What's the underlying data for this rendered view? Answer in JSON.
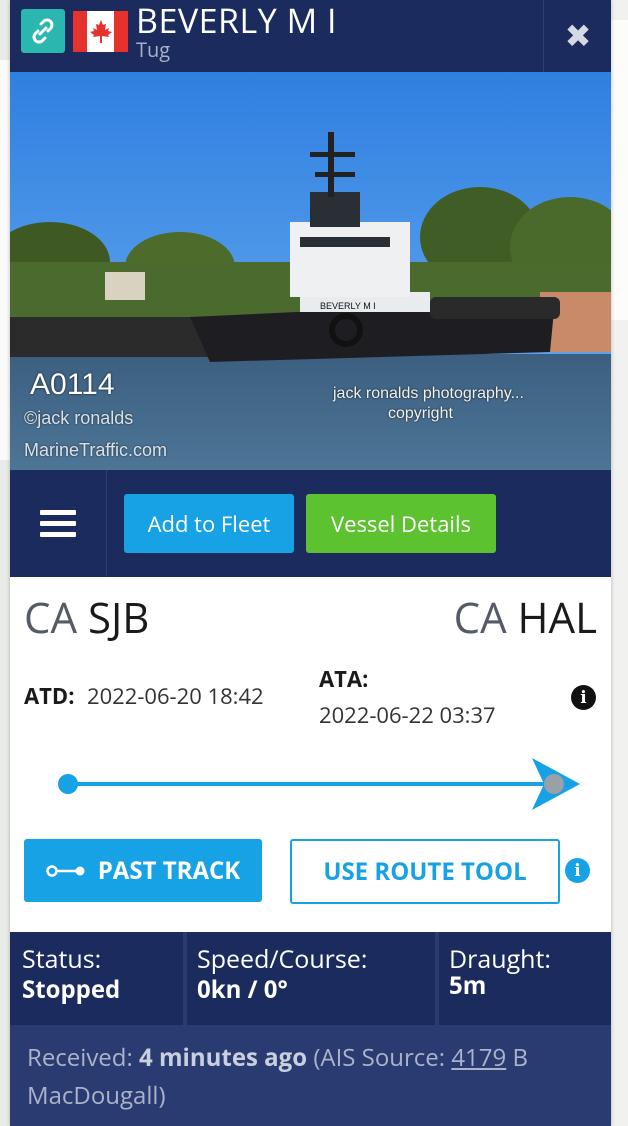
{
  "header": {
    "vessel_name": "BEVERLY M I",
    "vessel_type": "Tug",
    "close_symbol": "✖",
    "flag_country": "Canada"
  },
  "photo": {
    "caption_id": "A0114",
    "caption_credit": "©jack ronalds",
    "caption_site": "MarineTraffic.com",
    "watermark_line1": "jack ronalds photography...",
    "watermark_line2": "copyright",
    "hull_name": "BEVERLY M I"
  },
  "actions": {
    "add_to_fleet": "Add to Fleet",
    "vessel_details": "Vessel Details"
  },
  "voyage": {
    "origin_country": "CA",
    "origin_port": "SJB",
    "destination_country": "CA",
    "destination_port": "HAL",
    "atd_label": "ATD:",
    "atd_value": "2022-06-20 18:42",
    "ata_label": "ATA:",
    "ata_value": "2022-06-22 03:37",
    "progress": 1.0
  },
  "track": {
    "past_track": "PAST TRACK",
    "route_tool": "USE ROUTE TOOL"
  },
  "status": {
    "status_label": "Status:",
    "status_value": "Stopped",
    "speed_label": "Speed/Course:",
    "speed_value": "0kn / 0°",
    "draught_label": "Draught:",
    "draught_value": "5m"
  },
  "received": {
    "prefix": "Received: ",
    "time": "4 minutes ago",
    "source_prefix": " (AIS Source: ",
    "source_id": "4179",
    "source_suffix": " B MacDougall)"
  },
  "colors": {
    "navy": "#1b2b5e",
    "blue": "#17a2e5",
    "green": "#5dc22f",
    "teal": "#2bb6b0"
  }
}
